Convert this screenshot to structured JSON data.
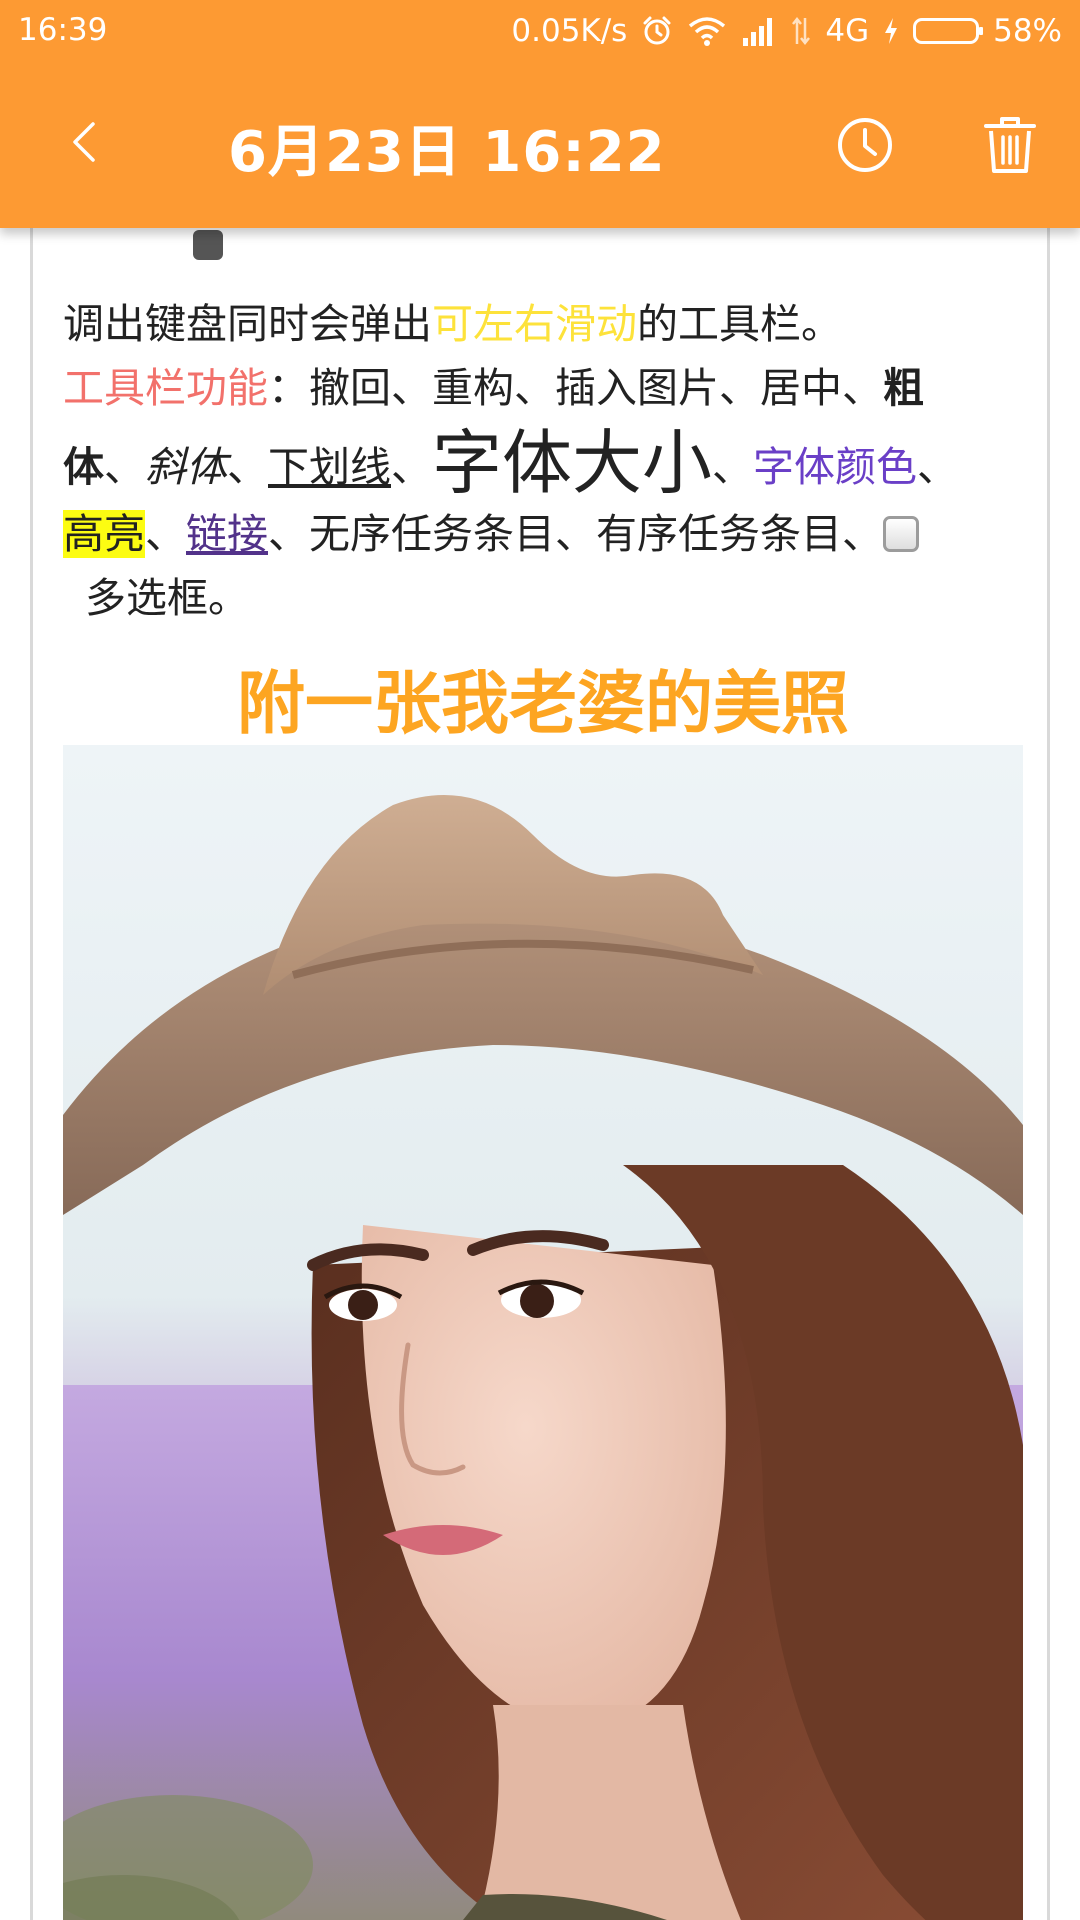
{
  "status_bar": {
    "time": "16:39",
    "speed": "0.05K/s",
    "network": "4G",
    "battery": "58%",
    "battery_level": 0.58
  },
  "title_bar": {
    "title": "6月23日 16:22",
    "back_icon": "chevron-left-icon",
    "reminder_icon": "clock-icon",
    "delete_icon": "trash-icon"
  },
  "note": {
    "line1": {
      "a": "调出键盘同时会弹出",
      "b": "可左右滑动",
      "c": "的工具栏。"
    },
    "line2": {
      "label": "工具栏功能",
      "rest": "：撤回、重构、插入图片、居中、",
      "bold_start": "粗"
    },
    "line3": {
      "bold_end": "体",
      "sep1": "、",
      "italic": "斜体",
      "sep2": "、",
      "underline": "下划线",
      "sep3": "、",
      "big": "字体大小",
      "sep4": "、",
      "color": "字体颜色",
      "sep5": "、"
    },
    "line4": {
      "highlight": "高亮",
      "sep1": "、",
      "link": "链接",
      "rest": "、无序任务条目、有序任务条目、"
    },
    "line5": "多选框。",
    "caption": "附一张我老婆的美照"
  },
  "colors": {
    "header": "#fd9a33",
    "slide_text": "#fde23a",
    "toolbar_label": "#f2716b",
    "font_color_sample": "#6a3fc7",
    "highlight": "#fcfc12",
    "link": "#52328a",
    "caption": "#fda521"
  }
}
